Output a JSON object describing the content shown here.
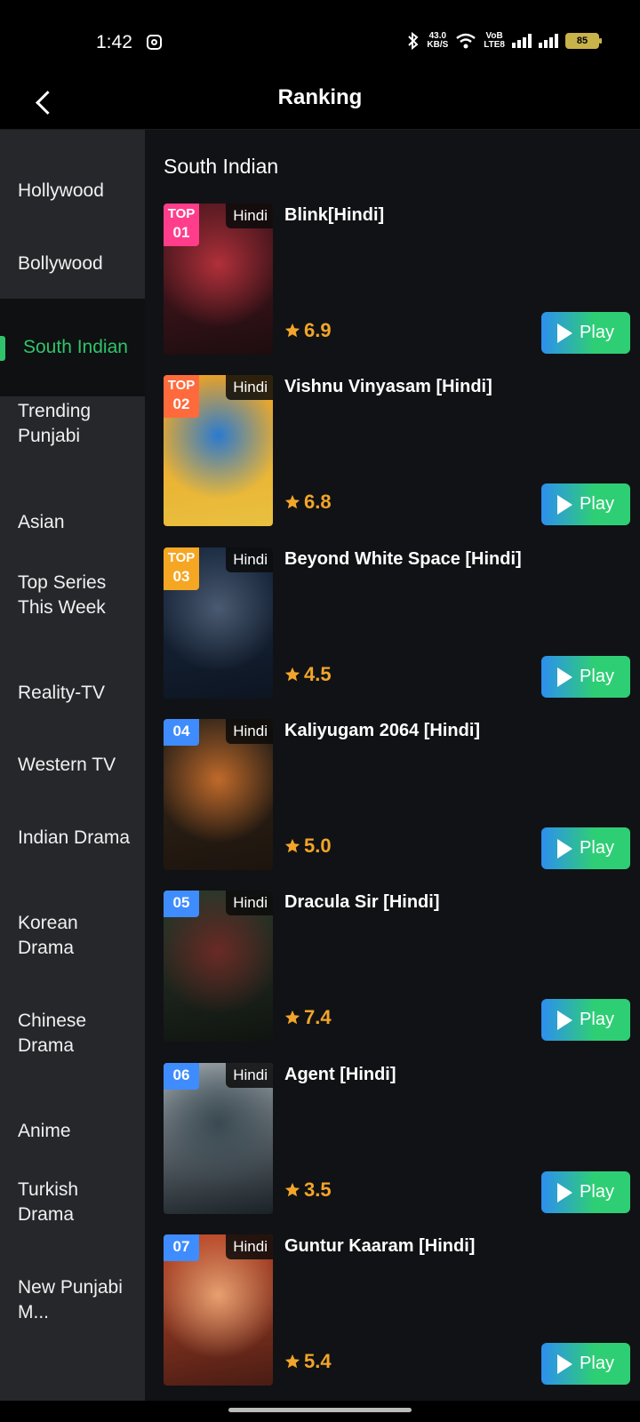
{
  "status_bar": {
    "time": "1:42",
    "net_speed_value": "43.0",
    "net_speed_unit": "KB/S",
    "volte_top": "VoB",
    "volte_bottom": "LTE8",
    "battery": "85"
  },
  "header": {
    "title": "Ranking"
  },
  "sidebar": {
    "active_index": 2,
    "items": [
      {
        "label": "Hollywood"
      },
      {
        "label": "Bollywood"
      },
      {
        "label": "South Indian"
      },
      {
        "label": "Trending Punjabi"
      },
      {
        "label": "Asian"
      },
      {
        "label": "Top Series This Week"
      },
      {
        "label": "Reality-TV"
      },
      {
        "label": "Western TV"
      },
      {
        "label": "Indian Drama"
      },
      {
        "label": "Korean Drama"
      },
      {
        "label": "Chinese Drama"
      },
      {
        "label": "Anime"
      },
      {
        "label": "Turkish Drama"
      },
      {
        "label": "New Punjabi M..."
      }
    ]
  },
  "main": {
    "section_title": "South Indian",
    "play_label": "Play",
    "items": [
      {
        "rank": "01",
        "top_label": "TOP",
        "lang": "Hindi",
        "title": "Blink[Hindi]",
        "rating": "6.9",
        "badge_color": "#ff3d8b",
        "poster_colors": [
          "#5b1a22",
          "#b0303a",
          "#1d0d10"
        ]
      },
      {
        "rank": "02",
        "top_label": "TOP",
        "lang": "Hindi",
        "title": "Vishnu Vinyasam [Hindi]",
        "rating": "6.8",
        "badge_color": "#ff6a3d",
        "poster_colors": [
          "#f0a020",
          "#2a7ad0",
          "#e8c040"
        ]
      },
      {
        "rank": "03",
        "top_label": "TOP",
        "lang": "Hindi",
        "title": "Beyond White Space [Hindi]",
        "rating": "4.5",
        "badge_color": "#f5a623",
        "poster_colors": [
          "#1b2c44",
          "#4a5a70",
          "#0d1522"
        ]
      },
      {
        "rank": "04",
        "top_label": "",
        "lang": "Hindi",
        "title": "Kaliyugam 2064 [Hindi]",
        "rating": "5.0",
        "badge_color": "#3f8cff",
        "poster_colors": [
          "#3a2a1c",
          "#c06a2a",
          "#1c140e"
        ]
      },
      {
        "rank": "05",
        "top_label": "",
        "lang": "Hindi",
        "title": "Dracula Sir [Hindi]",
        "rating": "7.4",
        "badge_color": "#3f8cff",
        "poster_colors": [
          "#2a3a2c",
          "#6a2a24",
          "#101410"
        ]
      },
      {
        "rank": "06",
        "top_label": "",
        "lang": "Hindi",
        "title": "Agent [Hindi]",
        "rating": "3.5",
        "badge_color": "#3f8cff",
        "poster_colors": [
          "#9aa4aa",
          "#3a4a52",
          "#1a2228"
        ]
      },
      {
        "rank": "07",
        "top_label": "",
        "lang": "Hindi",
        "title": "Guntur Kaaram [Hindi]",
        "rating": "5.4",
        "badge_color": "#3f8cff",
        "poster_colors": [
          "#c04a2a",
          "#e8a070",
          "#4a1c14"
        ]
      }
    ]
  }
}
